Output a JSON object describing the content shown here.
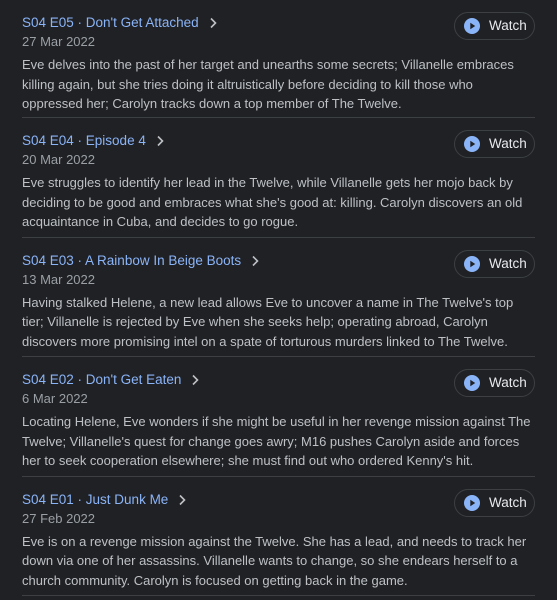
{
  "colors": {
    "background": "#202124",
    "title_link": "#8ab4f8",
    "date_text": "#9aa0a6",
    "body_text": "#bdc1c6",
    "play_icon": "#8ab4f8"
  },
  "episodes": [
    {
      "title": "S04 E05 · Don't Get Attached",
      "date": "27 Mar 2022",
      "description": "Eve delves into the past of her target and unearths some secrets; Villanelle embraces killing again, but she tries doing it altruistically before deciding to kill those who oppressed her; Carolyn tracks down a top member of The Twelve.",
      "watch_label": "Watch",
      "chevron_icon": "chevron-right-icon",
      "play_icon": "play-circle-icon"
    },
    {
      "title": "S04 E04 · Episode 4",
      "date": "20 Mar 2022",
      "description": "Eve struggles to identify her lead in the Twelve, while Villanelle gets her mojo back by deciding to be good and embraces what she's good at: killing. Carolyn discovers an old acquaintance in Cuba, and decides to go rogue.",
      "watch_label": "Watch",
      "chevron_icon": "chevron-right-icon",
      "play_icon": "play-circle-icon"
    },
    {
      "title": "S04 E03 · A Rainbow In Beige Boots",
      "date": "13 Mar 2022",
      "description": "Having stalked Helene, a new lead allows Eve to uncover a name in The Twelve's top tier; Villanelle is rejected by Eve when she seeks help; operating abroad, Carolyn discovers more promising intel on a spate of torturous murders linked to The Twelve.",
      "watch_label": "Watch",
      "chevron_icon": "chevron-right-icon",
      "play_icon": "play-circle-icon"
    },
    {
      "title": "S04 E02 · Don't Get Eaten",
      "date": "6 Mar 2022",
      "description": "Locating Helene, Eve wonders if she might be useful in her revenge mission against The Twelve; Villanelle's quest for change goes awry; M16 pushes Carolyn aside and forces her to seek cooperation elsewhere; she must find out who ordered Kenny's hit.",
      "watch_label": "Watch",
      "chevron_icon": "chevron-right-icon",
      "play_icon": "play-circle-icon"
    },
    {
      "title": "S04 E01 · Just Dunk Me",
      "date": "27 Feb 2022",
      "description": "Eve is on a revenge mission against the Twelve. She has a lead, and needs to track her down via one of her assassins. Villanelle wants to change, so she endears herself to a church community. Carolyn is focused on getting back in the game.",
      "watch_label": "Watch",
      "chevron_icon": "chevron-right-icon",
      "play_icon": "play-circle-icon"
    }
  ]
}
